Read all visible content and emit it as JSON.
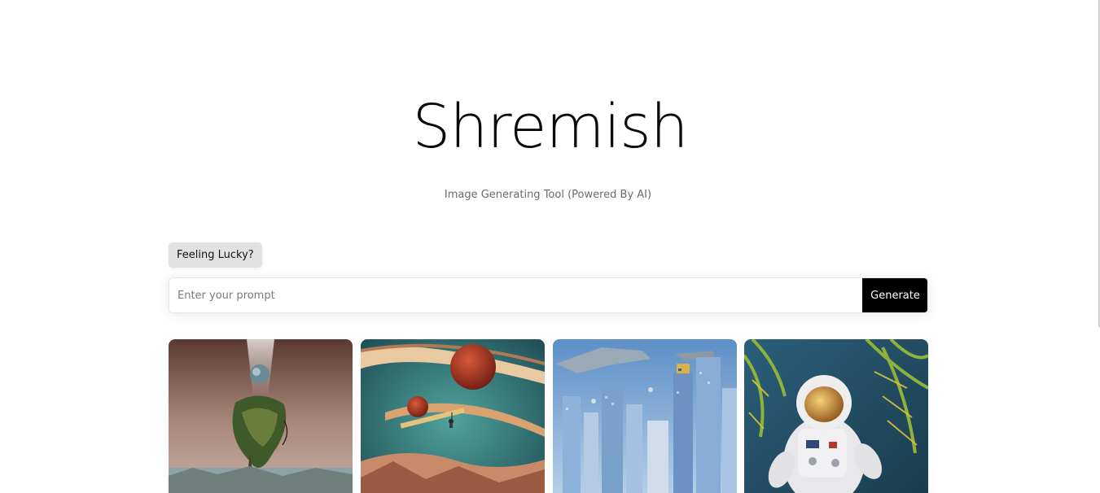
{
  "header": {
    "title": "Shremish",
    "subtitle": "Image Generating Tool (Powered By AI)"
  },
  "controls": {
    "lucky_label": "Feeling Lucky?",
    "prompt_placeholder": "Enter your prompt",
    "prompt_value": "",
    "generate_label": "Generate"
  },
  "gallery": {
    "images": [
      {
        "icon": "floating-island-image"
      },
      {
        "icon": "surreal-planets-image"
      },
      {
        "icon": "futuristic-city-image"
      },
      {
        "icon": "astronaut-palms-image"
      }
    ]
  },
  "colors": {
    "accent": "#000000",
    "lucky_bg": "#e2e2e2",
    "text": "#0b0b0b",
    "muted": "#6b6b6b"
  }
}
